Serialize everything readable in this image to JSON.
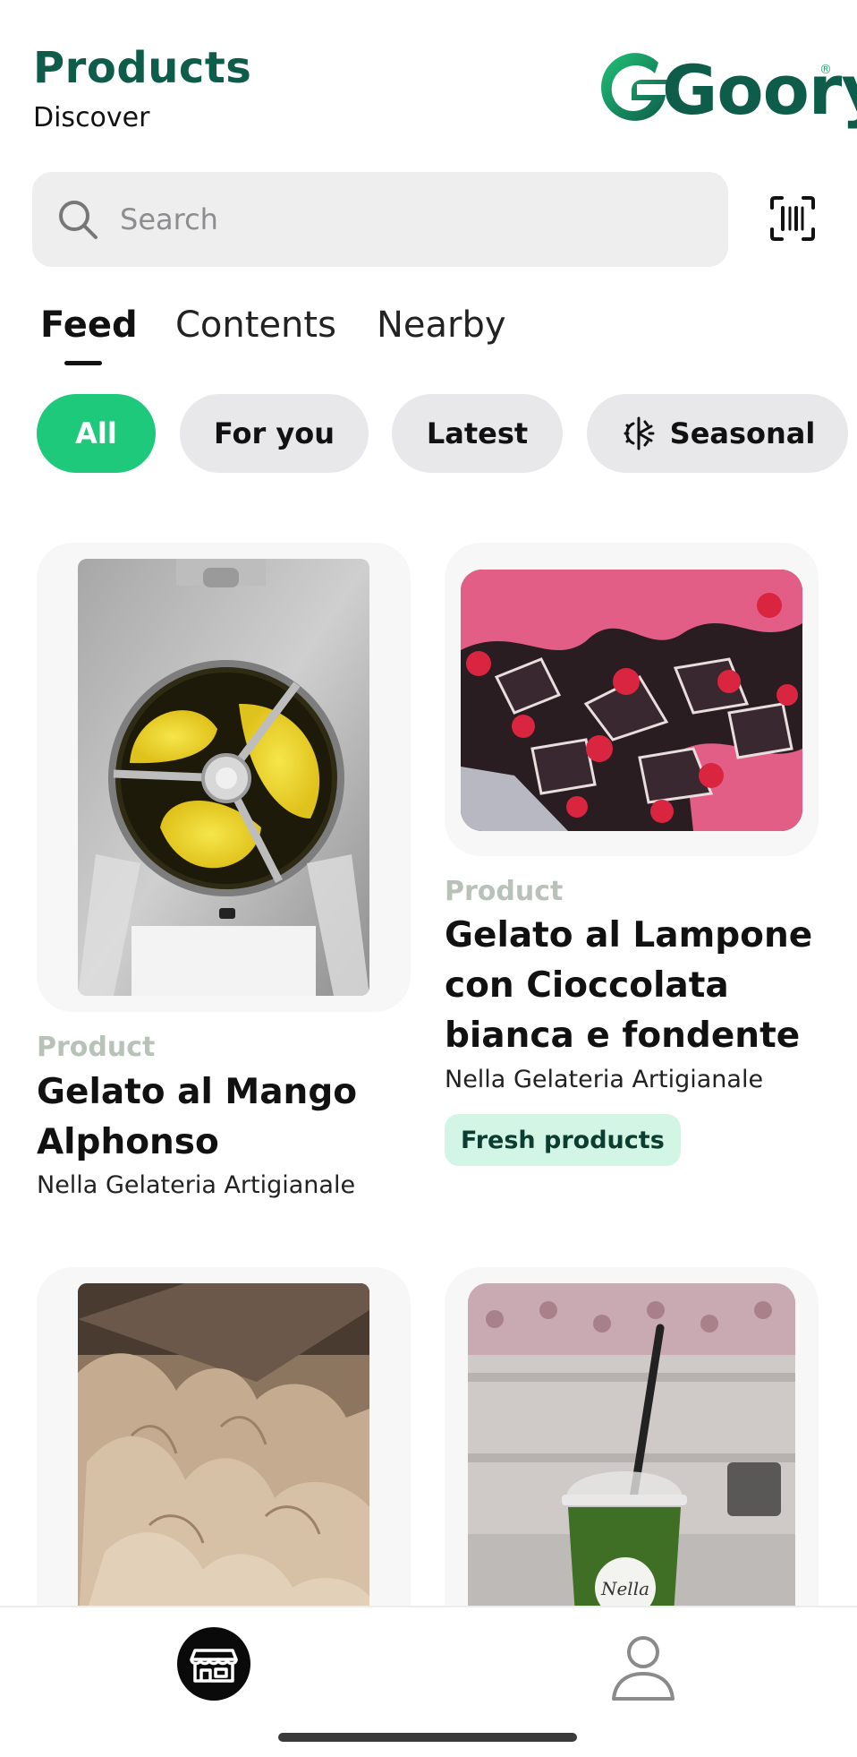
{
  "header": {
    "title": "Products",
    "subtitle": "Discover",
    "logo_text": "Goory",
    "logo_mark": "®",
    "brand_color": "#0e5c4a",
    "brand_accent": "#1db16a"
  },
  "search": {
    "placeholder": "Search",
    "value": "",
    "icon": "search-icon",
    "scan_icon": "barcode-scan-icon"
  },
  "tabs": [
    {
      "label": "Feed",
      "active": true
    },
    {
      "label": "Contents",
      "active": false
    },
    {
      "label": "Nearby",
      "active": false
    }
  ],
  "chips": [
    {
      "label": "All",
      "active": true
    },
    {
      "label": "For you",
      "active": false
    },
    {
      "label": "Latest",
      "active": false
    },
    {
      "label": "Seasonal",
      "active": false,
      "icon": "snow-sun-icon"
    }
  ],
  "accent_color": "#1ec97b",
  "cards": [
    {
      "kind": "Product",
      "title_lines": [
        "Gelato al Mango",
        "Alphonso"
      ],
      "place": "Nella Gelateria Artigianale",
      "image": "mango-gelato-machine-image"
    },
    {
      "kind": "Product",
      "title_lines": [
        "Gelato al Lampone",
        "con Cioccolata",
        "bianca e fondente"
      ],
      "place": "Nella Gelateria Artigianale",
      "badge": "Fresh products",
      "image": "raspberry-chocolate-gelato-image"
    },
    {
      "image": "coffee-gelato-image"
    },
    {
      "image": "green-smoothie-cup-image",
      "cup_label": "Nella"
    }
  ],
  "bottom_nav": {
    "items": [
      {
        "icon": "store-icon",
        "active": true
      },
      {
        "icon": "profile-icon",
        "active": false
      }
    ]
  }
}
